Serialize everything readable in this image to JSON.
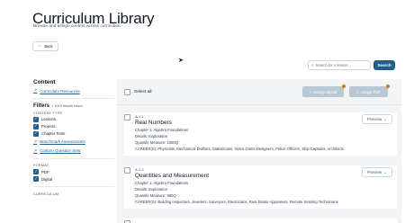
{
  "header": {
    "title": "Curriculum Library",
    "subtitle": "Browse and assign content across curriculum."
  },
  "back_label": "Back",
  "search": {
    "placeholder": "Search for a lesson...",
    "button_label": "Search"
  },
  "sidebar": {
    "content_heading": "Content",
    "curriculum_resources": "Curriculum Resources",
    "filters_heading": "Filters",
    "filters_count": "• 1019 results found",
    "content_type_label": "CONTENT TYPE",
    "content_types": [
      "Lessons",
      "Projects",
      "Chapter Tests"
    ],
    "benchmark": "Benchmark Assessments",
    "custom_sets": "Custom Question Sets",
    "format_label": "FORMAT",
    "formats": [
      "PDF",
      "Digital"
    ],
    "curriculum_label": "CURRICULUM"
  },
  "toolbar": {
    "select_all": "Select all",
    "assign_digital": "Assign Digital",
    "assign_pdf": "Assign PDF"
  },
  "lessons": [
    {
      "code": "A-1.1",
      "title": "Real Numbers",
      "chapter": "Chapter 1: Algebra Foundations",
      "details": "Details: Exploration",
      "quantile": "Quantile Measure: 1000Q",
      "careers": "CAREER(S): Physicists, Mechanical Drafters, Statisticians, Video Game Designers, Police Officers, Ship Captains, Architects",
      "preview_label": "Preview"
    },
    {
      "code": "A-1.2",
      "title": "Quantities and Measurement",
      "chapter": "Chapter 1: Algebra Foundations",
      "details": "Details: Exploration",
      "quantile": "Quantile Measure: 990Q",
      "careers": "CAREER(S): Building Inspectors, Jewelers, Surveyors, Electricians, Real Estate Appraisers, Remote Sensing Technicians",
      "preview_label": "Preview"
    }
  ],
  "colors": {
    "accent": "#1f5f8b",
    "disabled_button": "#b9c8d4",
    "badge": "#d97706"
  }
}
